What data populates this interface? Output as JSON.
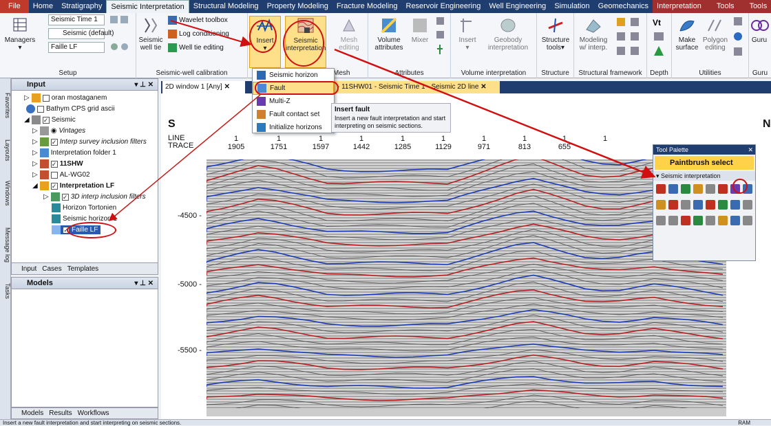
{
  "tabs": [
    "File",
    "Home",
    "Stratigraphy",
    "Seismic Interpretation",
    "Structural Modeling",
    "Property Modeling",
    "Fracture Modeling",
    "Reservoir Engineering",
    "Well Engineering",
    "Simulation",
    "Geomechanics",
    "Interpretation",
    "Tools",
    "Tools"
  ],
  "ribbon": {
    "setup": {
      "label": "Setup",
      "managers": "Managers",
      "combo1": "Seismic Time 1",
      "combo2": "Seismic (default)",
      "combo3": "Faille LF"
    },
    "well_calib": {
      "label": "Seismic-well calibration",
      "btn": "Seismic well tie",
      "item1": "Wavelet toolbox",
      "item2": "Log conditioning",
      "item3": "Well tie editing"
    },
    "insert": {
      "label": "Insert"
    },
    "seismic_interp": {
      "label": "Seismic interpretation"
    },
    "mesh": {
      "label": "Mesh editing",
      "group": "Mesh"
    },
    "attributes": {
      "group": "Attributes",
      "volume": "Volume attributes",
      "mixer": "Mixer"
    },
    "volume_interp": {
      "group": "Volume interpretation",
      "insert": "Insert",
      "geobody": "Geobody interpretation"
    },
    "structure": {
      "group": "Structure",
      "btn": "Structure tools"
    },
    "framework": {
      "group": "Structural framework",
      "btn": "Modeling w/ interp."
    },
    "depth": {
      "group": "Depth"
    },
    "utilities": {
      "group": "Utilities",
      "make": "Make surface",
      "polygon": "Polygon editing"
    },
    "guru": {
      "label": "Guru",
      "group": "Guru"
    }
  },
  "dropdown": [
    "Seismic horizon",
    "Fault",
    "Multi-Z",
    "Fault contact set",
    "Initialize horizons"
  ],
  "tooltip": {
    "title": "Insert fault",
    "body": "Insert a new fault interpretation and start interpreting on seismic sections."
  },
  "input_panel": {
    "title": "Input",
    "items": [
      "oran mostaganem",
      "Bathym CPS grid ascii",
      "Seismic",
      "Vintages",
      "Interp survey inclusion filters",
      "Interpretation folder 1",
      "11SHW",
      "AL-WG02",
      "Interpretation LF",
      "3D interp inclusion filters",
      "Horizon Tortonien",
      "Seismic horizon 1",
      "Faille LF"
    ]
  },
  "bottom_tabs1": [
    "Input",
    "Cases",
    "Templates"
  ],
  "models_panel": {
    "title": "Models"
  },
  "bottom_tabs2": [
    "Models",
    "Results",
    "Workflows"
  ],
  "side_tabs": [
    "Favorites",
    "Layouts",
    "Windows",
    "Message log",
    "Tasks"
  ],
  "doc_tabs": [
    "2D window 1 [Any]",
    "- 11SHW01 - Seismic Time 1 - Seismic 2D line"
  ],
  "section": {
    "left": "S",
    "right": "N",
    "line_label": "LINE",
    "trace_label": "TRACE",
    "line_values": [
      "1",
      "1",
      "1",
      "1",
      "1",
      "1",
      "1",
      "1",
      "1",
      "1"
    ],
    "traces": [
      "1905",
      "1751",
      "1597",
      "1442",
      "1285",
      "1129",
      "971",
      "813",
      "655",
      ""
    ],
    "depths": [
      "-4500",
      "-5000",
      "-5500"
    ]
  },
  "palette": {
    "title": "Tool Palette",
    "select": "Paintbrush select",
    "section": "Seismic interpretation"
  },
  "status": "Insert a new fault interpretation and start interpreting on seismic sections.",
  "status_right": "RAM",
  "colors": {
    "accent": "#1f3d6e",
    "highlight": "#d01010",
    "select": "#ffd24a"
  }
}
